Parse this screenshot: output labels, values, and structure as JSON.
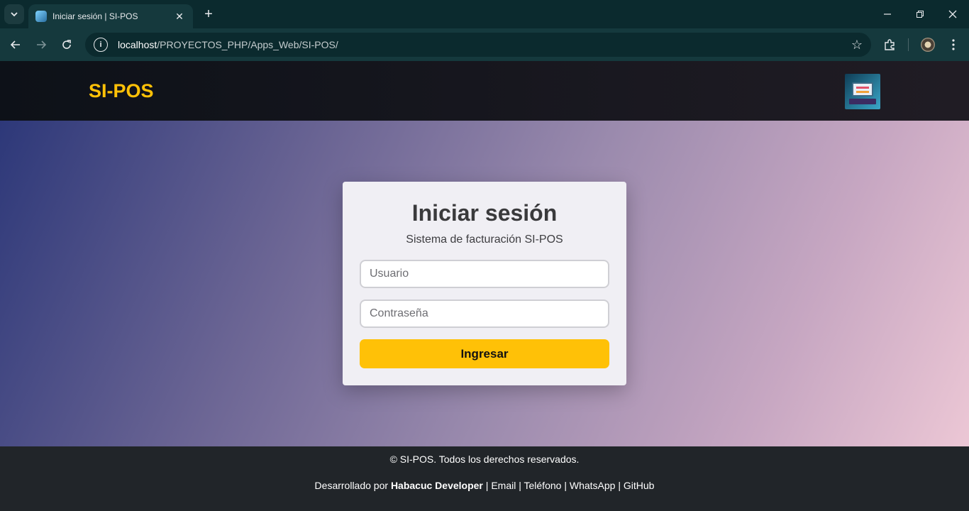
{
  "browser": {
    "tab_title": "Iniciar sesión | SI-POS",
    "url_host": "localhost",
    "url_path": "/PROYECTOS_PHP/Apps_Web/SI-POS/",
    "icons": {
      "tab_list": "chevron-down-icon",
      "close_tab": "close-icon",
      "new_tab": "plus-icon",
      "minimize": "minimize-icon",
      "restore": "restore-icon",
      "close_window": "close-icon",
      "back": "back-arrow-icon",
      "forward": "forward-arrow-icon",
      "reload": "reload-icon",
      "site_info": "info-icon",
      "bookmark": "star-icon",
      "extensions": "puzzle-icon",
      "profile": "avatar",
      "menu": "kebab-menu-icon"
    }
  },
  "header": {
    "brand": "SI-POS",
    "brand_color": "#ffc107"
  },
  "login": {
    "title": "Iniciar sesión",
    "subtitle": "Sistema de facturación SI-POS",
    "username_placeholder": "Usuario",
    "password_placeholder": "Contraseña",
    "submit_label": "Ingresar",
    "submit_color": "#ffc107"
  },
  "footer": {
    "copyright": "© SI-POS. Todos los derechos reservados.",
    "developed_by": "Desarrollado por ",
    "developer": "Habacuc Developer",
    "sep": " | ",
    "links": {
      "email": "Email",
      "phone": "Teléfono",
      "whatsapp": "WhatsApp",
      "github": "GitHub"
    }
  }
}
